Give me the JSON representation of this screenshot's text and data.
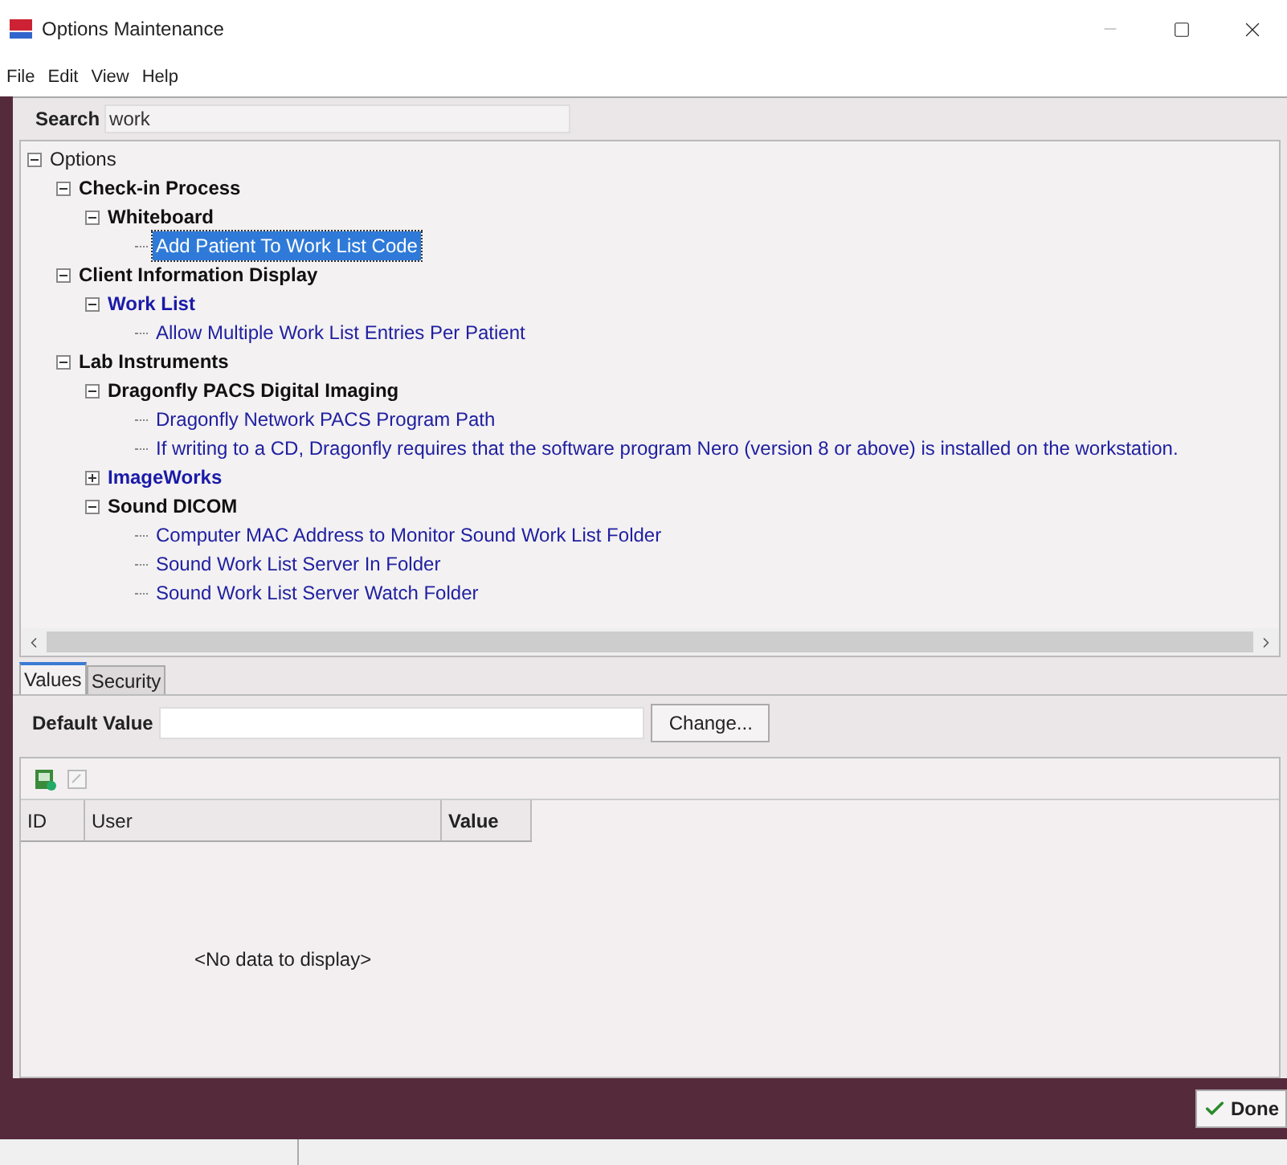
{
  "window": {
    "title": "Options Maintenance"
  },
  "menu": [
    "File",
    "Edit",
    "View",
    "Help"
  ],
  "search": {
    "label": "Search",
    "value": "work"
  },
  "tree": [
    {
      "label": "Options",
      "kind": "root",
      "expanded": true,
      "children": [
        {
          "label": "Check-in Process",
          "kind": "group",
          "matched": false,
          "expanded": true,
          "children": [
            {
              "label": "Whiteboard",
              "kind": "group",
              "matched": false,
              "expanded": true,
              "children": [
                {
                  "label": "Add Patient To Work List Code",
                  "kind": "option",
                  "selected": true
                }
              ]
            }
          ]
        },
        {
          "label": "Client Information Display",
          "kind": "group",
          "matched": false,
          "expanded": true,
          "children": [
            {
              "label": "Work List",
              "kind": "group",
              "matched": true,
              "expanded": true,
              "children": [
                {
                  "label": "Allow Multiple Work List Entries Per Patient",
                  "kind": "option",
                  "selected": false
                }
              ]
            }
          ]
        },
        {
          "label": "Lab Instruments",
          "kind": "group",
          "matched": false,
          "expanded": true,
          "children": [
            {
              "label": "Dragonfly PACS Digital Imaging",
              "kind": "group",
              "matched": false,
              "expanded": true,
              "children": [
                {
                  "label": "Dragonfly Network PACS Program Path",
                  "kind": "option",
                  "selected": false
                },
                {
                  "label": "If writing to a CD, Dragonfly requires that the software program Nero (version 8 or above) is installed on the workstation.",
                  "kind": "option",
                  "selected": false
                }
              ]
            },
            {
              "label": "ImageWorks",
              "kind": "group",
              "matched": true,
              "expanded": false
            },
            {
              "label": "Sound DICOM",
              "kind": "group",
              "matched": false,
              "expanded": true,
              "children": [
                {
                  "label": "Computer MAC Address to Monitor Sound Work List Folder",
                  "kind": "option",
                  "selected": false
                },
                {
                  "label": "Sound Work List Server In Folder",
                  "kind": "option",
                  "selected": false
                },
                {
                  "label": "Sound Work List Server Watch Folder",
                  "kind": "option",
                  "selected": false
                }
              ]
            }
          ]
        }
      ]
    }
  ],
  "tabs": [
    {
      "label": "Values",
      "selected": true
    },
    {
      "label": "Security",
      "selected": false
    }
  ],
  "default_value": {
    "label": "Default Value",
    "button": "Change..."
  },
  "grid": {
    "columns": [
      "ID",
      "User",
      "Value"
    ],
    "empty_text": "<No data to display>"
  },
  "done_button": "Done"
}
